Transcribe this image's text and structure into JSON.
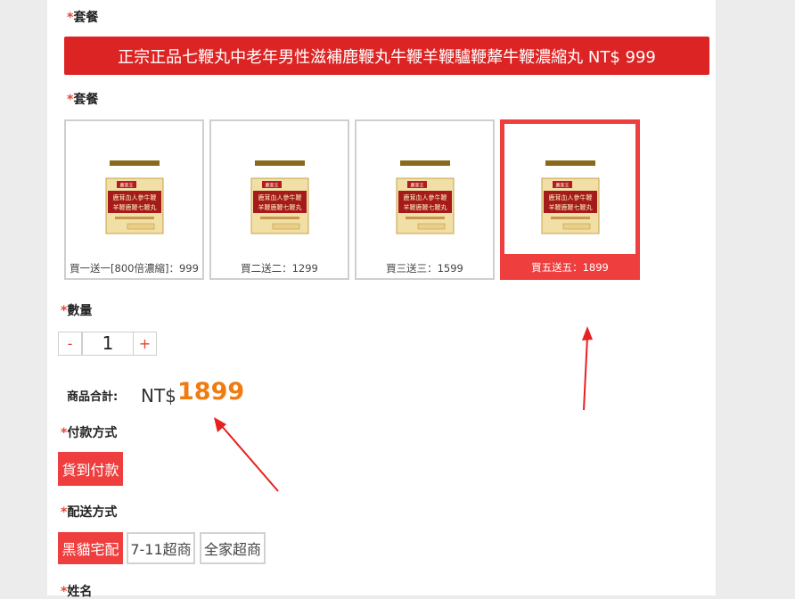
{
  "package_label_1": "套餐",
  "banner_text": "正宗正品七鞭丸中老年男性滋補鹿鞭丸牛鞭羊鞭驢鞭犛牛鞭濃縮丸 NT$ 999",
  "package_label_2": "套餐",
  "required_mark": "*",
  "bottle_brand": "鹿家王",
  "bottle_title_line1": "鹿茸血人參牛鞭",
  "bottle_title_line2": "羊鞭鹿鞭七鞭丸",
  "options": [
    {
      "label": "買一送一[800倍濃縮]：999",
      "selected": false
    },
    {
      "label": "買二送二：1299",
      "selected": false
    },
    {
      "label": "買三送三：1599",
      "selected": false
    },
    {
      "label": "買五送五：1899",
      "selected": true
    }
  ],
  "quantity": {
    "label": "數量",
    "minus": "-",
    "value": "1",
    "plus": "+"
  },
  "total": {
    "label": "商品合計:",
    "currency": "NT$",
    "amount": "1899"
  },
  "payment": {
    "label": "付款方式",
    "options": [
      "貨到付款"
    ]
  },
  "delivery": {
    "label": "配送方式",
    "options": [
      "黑貓宅配",
      "7-11超商",
      "全家超商"
    ]
  },
  "name_label": "姓名",
  "colors": {
    "accent": "#ef3e3e",
    "banner": "#dd2424",
    "price": "#f07c11"
  }
}
